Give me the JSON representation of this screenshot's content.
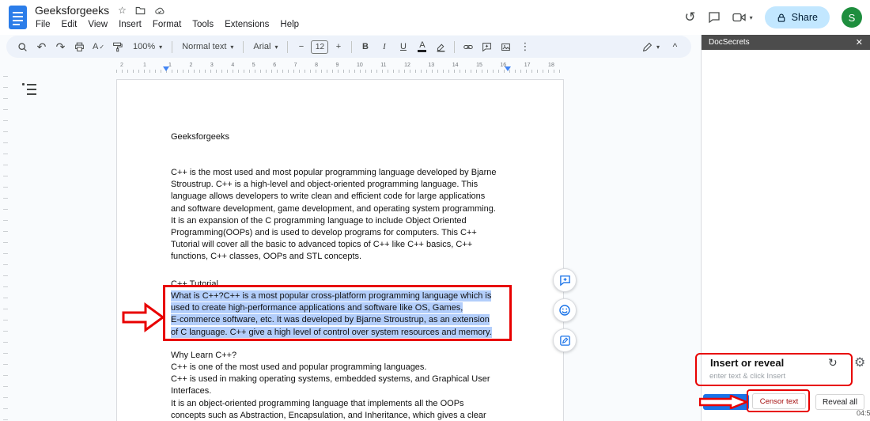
{
  "app": {
    "title": "Geeksforgeeks",
    "menus": [
      "File",
      "Edit",
      "View",
      "Insert",
      "Format",
      "Tools",
      "Extensions",
      "Help"
    ],
    "share_label": "Share",
    "avatar_letter": "S"
  },
  "toolbar": {
    "zoom": "100%",
    "paragraph_style": "Normal text",
    "font": "Arial",
    "font_size": "12",
    "minus": "−",
    "plus": "+",
    "bold": "B",
    "italic": "I",
    "underline": "U",
    "text_color": "A",
    "more": "⋮",
    "collapse": "^",
    "undo": "↶",
    "redo": "↷"
  },
  "ruler": {
    "pre_numbers": [
      "2",
      "1"
    ],
    "numbers": [
      "1",
      "2",
      "3",
      "4",
      "5",
      "6",
      "7",
      "8",
      "9",
      "10",
      "11",
      "12",
      "13",
      "14",
      "15",
      "16",
      "17",
      "18"
    ]
  },
  "document": {
    "heading": "Geeksforgeeks",
    "para1_lines": [
      "C++ is the most used and most popular programming language developed by Bjarne",
      "Stroustrup. C++ is a high-level and object-oriented programming language. This",
      "language allows developers to write clean and efficient code for large applications",
      "and software development, game development, and operating system programming.",
      "It is an expansion of the C programming language to include Object Oriented",
      "Programming(OOPs) and is used to develop programs for computers. This C++",
      "Tutorial will cover all the basic to advanced topics of C++ like C++ basics, C++",
      "functions, C++ classes, OOPs and STL concepts."
    ],
    "section1_title": "C++ Tutorial",
    "highlight_lines": [
      "What is C++?C++ is a most popular cross-platform programming language which is",
      "used to create high-performance applications and software like OS, Games,",
      "E-commerce software, etc. It was developed by Bjarne Stroustrup, as an extension",
      "of C language. C++ give a high level of control over system resources and memory."
    ],
    "section2_title": "Why Learn C++?",
    "para2_lines": [
      "C++ is one of the most used and popular programming languages.",
      "C++ is used in making operating systems, embedded systems, and Graphical User",
      "Interfaces.",
      "It is an object-oriented programming language that implements all the OOPs",
      "concepts such as Abstraction, Encapsulation, and Inheritance, which gives a clear"
    ]
  },
  "panel": {
    "title": "DocSecrets",
    "close": "✕",
    "insert_reveal_label": "Insert or reveal",
    "refresh": "↻",
    "gear": "⚙",
    "input_placeholder": "enter text & click Insert",
    "insert_button": "Insert",
    "censor_button": "Censor text",
    "reveal_button": "Reveal all"
  },
  "status": {
    "clock": "04:5"
  },
  "colors": {
    "accent_blue": "#1a73e8",
    "share_bg": "#c2e7ff",
    "selection_blue": "#b3cefb",
    "annotation_red": "#e80000",
    "panel_header_gray": "#4c4c4c",
    "avatar_green": "#1e8e3e"
  }
}
